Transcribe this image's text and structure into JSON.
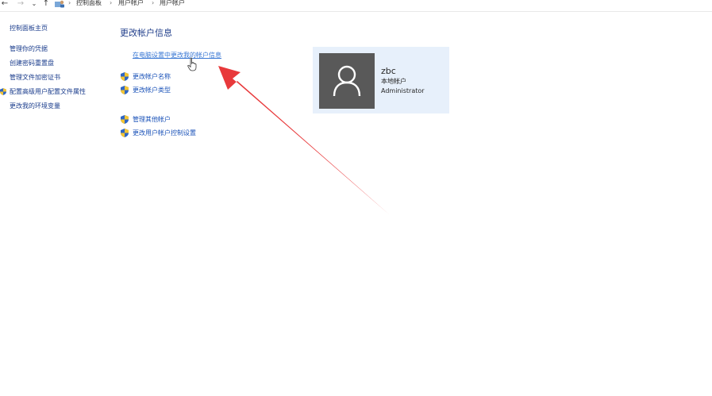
{
  "nav": {
    "back": "←",
    "forward": "→",
    "recent": "⌄",
    "up": "↑"
  },
  "breadcrumb": {
    "separator": "›",
    "items": [
      "控制面板",
      "用户帐户",
      "用户帐户"
    ]
  },
  "sidebar": {
    "items": [
      {
        "label": "控制面板主页"
      },
      {
        "label": "管理你的凭据"
      },
      {
        "label": "创建密码重置盘"
      },
      {
        "label": "管理文件加密证书"
      },
      {
        "label": "配置高级用户配置文件属性"
      },
      {
        "label": "更改我的环境变量"
      }
    ]
  },
  "main": {
    "heading": "更改帐户信息",
    "primary_link": "在电脑设置中更改我的帐户信息",
    "links": [
      {
        "label": "更改帐户名称"
      },
      {
        "label": "更改帐户类型"
      }
    ],
    "links2": [
      {
        "label": "管理其他帐户"
      },
      {
        "label": "更改用户帐户控制设置"
      }
    ]
  },
  "account": {
    "name": "zbc",
    "type": "本地帐户",
    "role": "Administrator"
  },
  "colors": {
    "link": "#1a52b8",
    "heading": "#1f3d8a",
    "card_bg": "#e7f0fb",
    "avatar_bg": "#595959",
    "arrow": "#e8393b"
  },
  "icons": {
    "shield": "uac-shield-icon",
    "user": "user-avatar-icon",
    "cursor": "hand-cursor-icon",
    "annotation": "red-arrow-annotation"
  }
}
